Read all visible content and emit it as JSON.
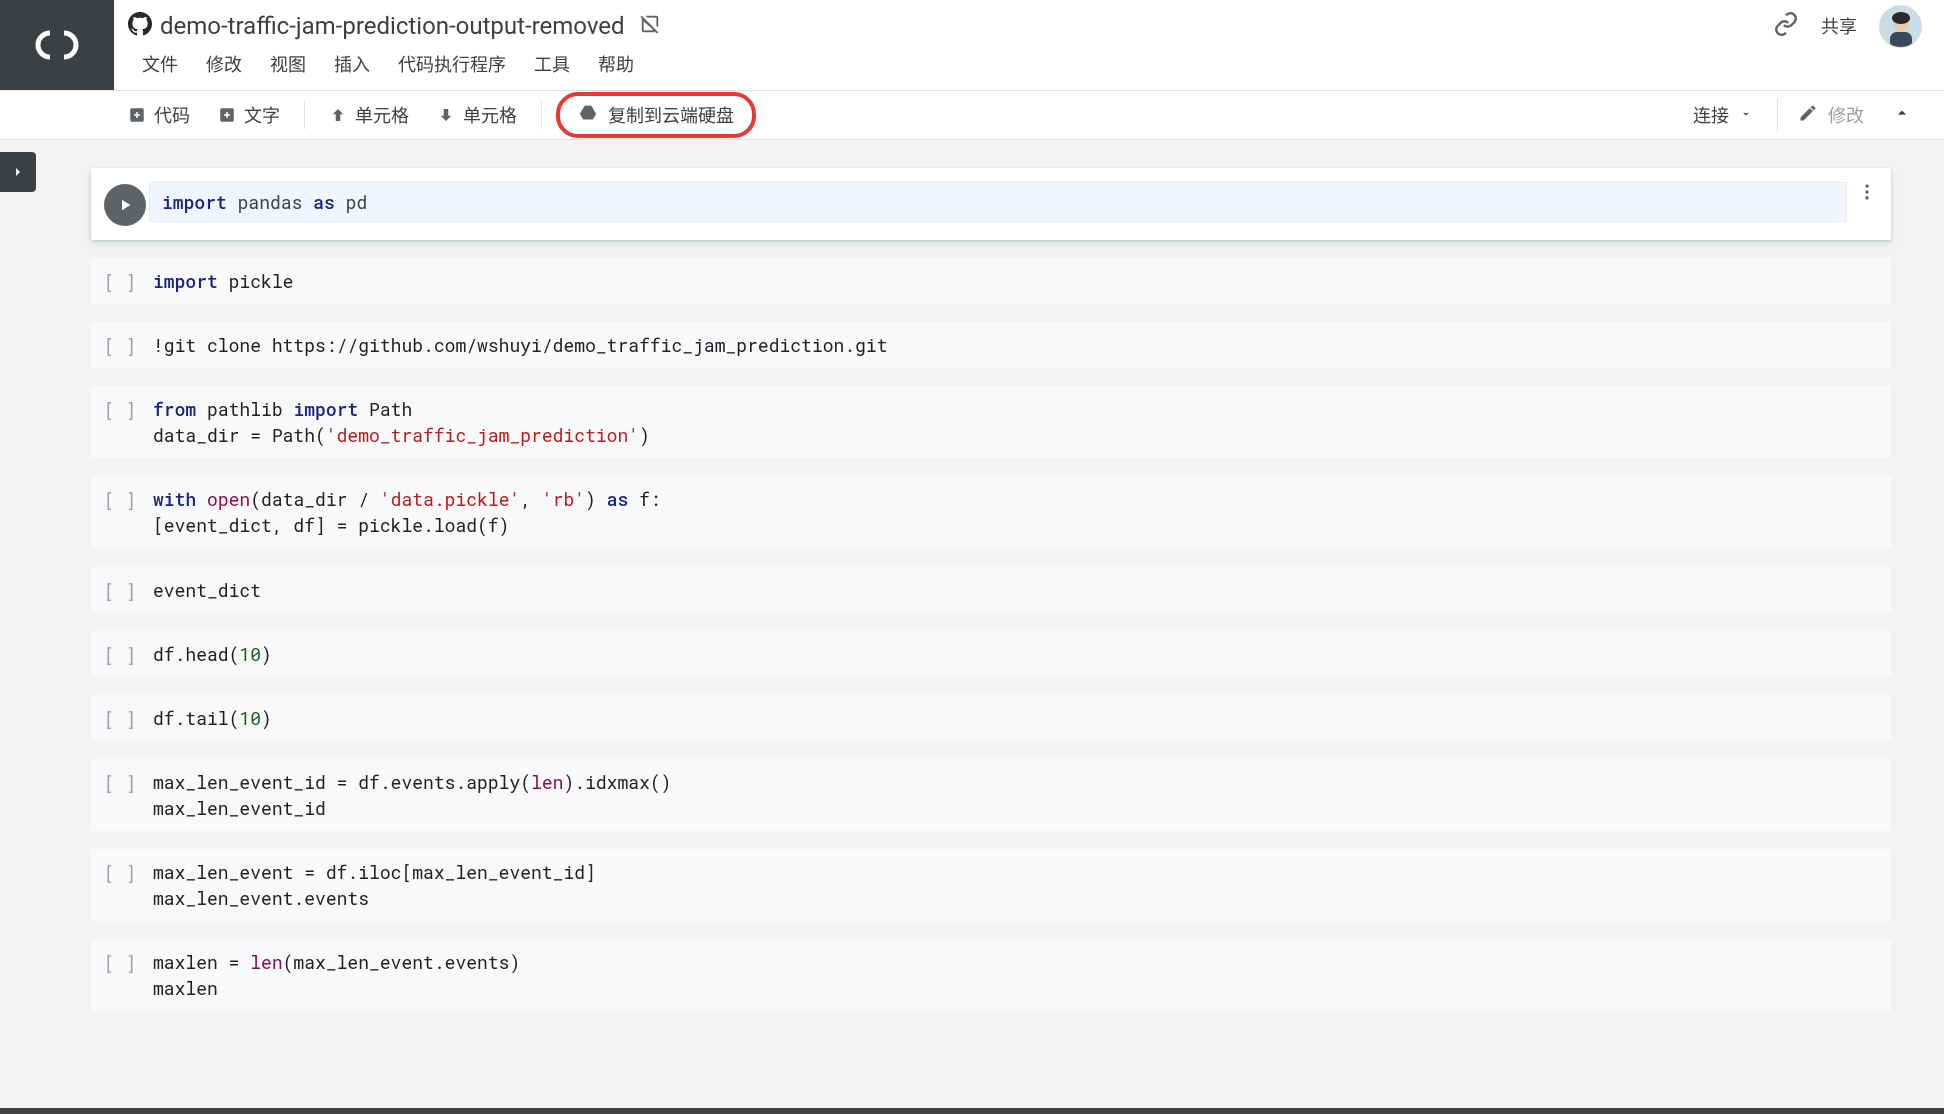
{
  "header": {
    "title": "demo-traffic-jam-prediction-output-removed",
    "share_label": "共享"
  },
  "menus": [
    "文件",
    "修改",
    "视图",
    "插入",
    "代码执行程序",
    "工具",
    "帮助"
  ],
  "toolbar": {
    "code": "代码",
    "text": "文字",
    "cell_up": "单元格",
    "cell_down": "单元格",
    "copy_drive": "复制到云端硬盘",
    "connect": "连接",
    "edit": "修改"
  },
  "gutter_label": "[ ]",
  "cells": [
    {
      "active": true,
      "tokens": [
        {
          "t": "import",
          "c": "kw"
        },
        {
          "t": " pandas ",
          "c": ""
        },
        {
          "t": "as",
          "c": "kw"
        },
        {
          "t": " pd",
          "c": ""
        }
      ]
    },
    {
      "tokens": [
        {
          "t": "import",
          "c": "kw"
        },
        {
          "t": " pickle",
          "c": ""
        }
      ]
    },
    {
      "tokens": [
        {
          "t": "!git clone https://github.com/wshuyi/demo_traffic_jam_prediction.git",
          "c": ""
        }
      ]
    },
    {
      "lines": [
        [
          {
            "t": "from",
            "c": "kw"
          },
          {
            "t": " pathlib ",
            "c": ""
          },
          {
            "t": "import",
            "c": "kw"
          },
          {
            "t": " Path",
            "c": ""
          }
        ],
        [
          {
            "t": "data_dir = Path(",
            "c": ""
          },
          {
            "t": "'demo_traffic_jam_prediction'",
            "c": "str"
          },
          {
            "t": ")",
            "c": ""
          }
        ]
      ]
    },
    {
      "lines": [
        [
          {
            "t": "with",
            "c": "kw"
          },
          {
            "t": " ",
            "c": ""
          },
          {
            "t": "open",
            "c": "fn"
          },
          {
            "t": "(data_dir / ",
            "c": ""
          },
          {
            "t": "'data.pickle'",
            "c": "str"
          },
          {
            "t": ", ",
            "c": ""
          },
          {
            "t": "'rb'",
            "c": "str"
          },
          {
            "t": ") ",
            "c": ""
          },
          {
            "t": "as",
            "c": "kw"
          },
          {
            "t": " f:",
            "c": ""
          }
        ],
        [
          {
            "t": "    [event_dict, df] = pickle.load(f)",
            "c": ""
          }
        ]
      ]
    },
    {
      "tokens": [
        {
          "t": "event_dict",
          "c": ""
        }
      ]
    },
    {
      "tokens": [
        {
          "t": "df.head(",
          "c": ""
        },
        {
          "t": "10",
          "c": "num"
        },
        {
          "t": ")",
          "c": ""
        }
      ]
    },
    {
      "tokens": [
        {
          "t": "df.tail(",
          "c": ""
        },
        {
          "t": "10",
          "c": "num"
        },
        {
          "t": ")",
          "c": ""
        }
      ]
    },
    {
      "lines": [
        [
          {
            "t": "max_len_event_id = df.events.apply(",
            "c": ""
          },
          {
            "t": "len",
            "c": "fn"
          },
          {
            "t": ").idxmax()",
            "c": ""
          }
        ],
        [
          {
            "t": "max_len_event_id",
            "c": ""
          }
        ]
      ]
    },
    {
      "lines": [
        [
          {
            "t": "max_len_event = df.iloc[max_len_event_id]",
            "c": ""
          }
        ],
        [
          {
            "t": "max_len_event.events",
            "c": ""
          }
        ]
      ]
    },
    {
      "lines": [
        [
          {
            "t": "maxlen = ",
            "c": ""
          },
          {
            "t": "len",
            "c": "fn"
          },
          {
            "t": "(max_len_event.events)",
            "c": ""
          }
        ],
        [
          {
            "t": "maxlen",
            "c": ""
          }
        ]
      ]
    }
  ]
}
